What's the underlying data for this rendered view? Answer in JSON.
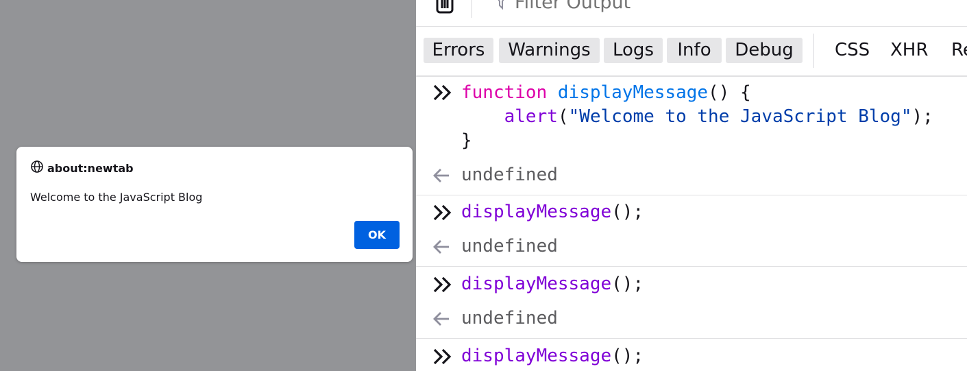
{
  "alert": {
    "origin": "about:newtab",
    "message": "Welcome to the JavaScript Blog",
    "ok_label": "OK"
  },
  "toolbar": {
    "filter_placeholder": "Filter Output"
  },
  "categories": {
    "errors": "Errors",
    "warnings": "Warnings",
    "logs": "Logs",
    "info": "Info",
    "debug": "Debug",
    "css": "CSS",
    "xhr": "XHR",
    "requests_partial": "Re"
  },
  "console": {
    "entry1": {
      "kw": "function",
      "name": "displayMessage",
      "sig_rest": "() {",
      "indent": "    ",
      "call": "alert",
      "paren_open": "(",
      "str": "\"Welcome to the JavaScript Blog\"",
      "paren_close": ");",
      "brace": "}",
      "result": "undefined"
    },
    "entry2": {
      "call": "displayMessage",
      "rest": "();",
      "result": "undefined"
    },
    "entry3": {
      "call": "displayMessage",
      "rest": "();",
      "result": "undefined"
    },
    "entry4": {
      "call": "displayMessage",
      "rest": "();"
    }
  },
  "colors": {
    "keyword": "#dd00a9",
    "function_name": "#0074e8",
    "call": "#8000d7",
    "string": "#003eaa",
    "ok_button": "#0061e0",
    "overlay": "#939497"
  }
}
